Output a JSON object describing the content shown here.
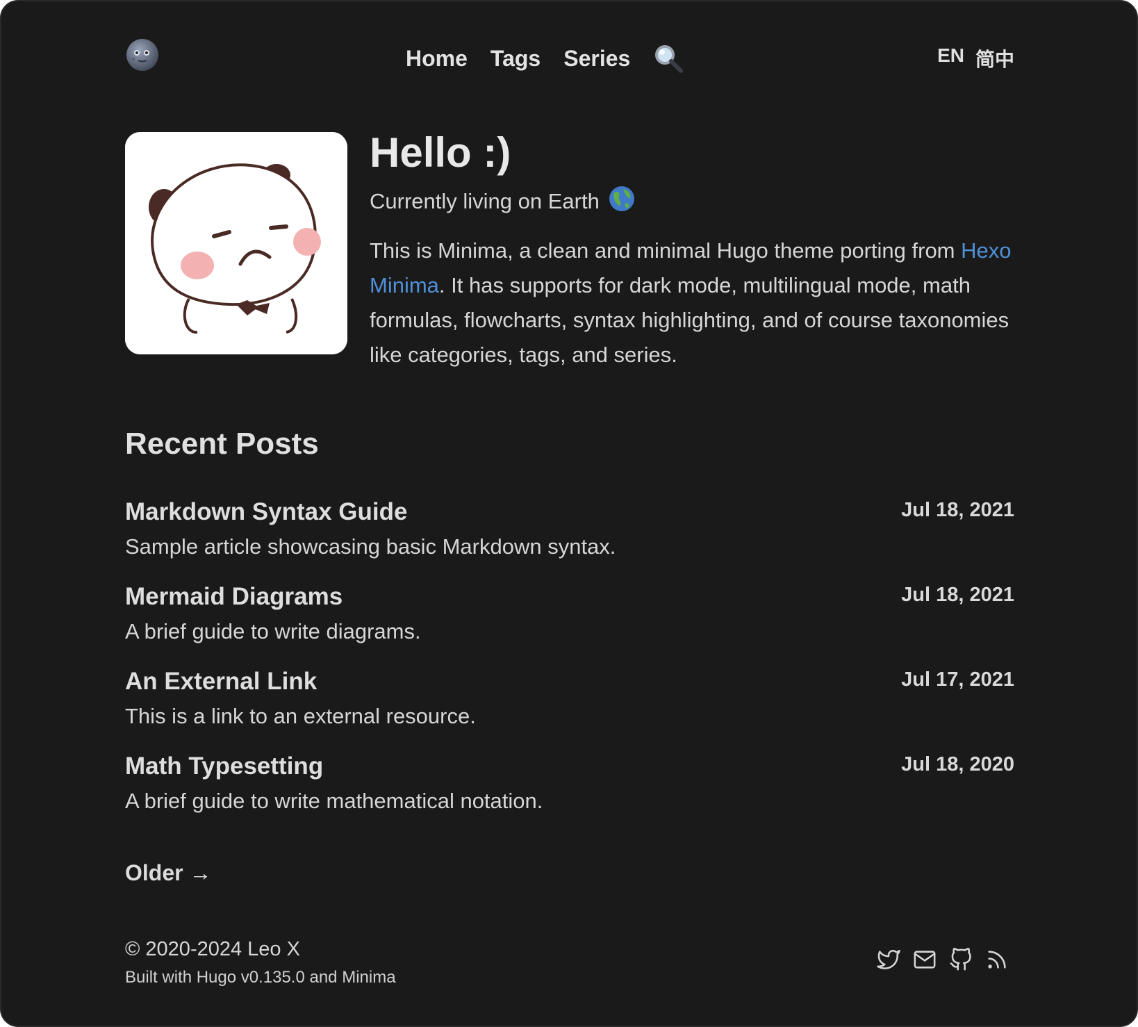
{
  "header": {
    "logo_icon": "moon-face-icon",
    "nav": [
      "Home",
      "Tags",
      "Series"
    ],
    "search_icon": "magnifier-icon",
    "languages": [
      "EN",
      "简中"
    ]
  },
  "intro": {
    "avatar_icon": "panda-sticker-image",
    "title": "Hello :)",
    "subtitle": "Currently living on Earth",
    "subtitle_icon": "earth-globe-icon",
    "bio_before_link": "This is Minima, a clean and minimal Hugo theme porting from ",
    "bio_link": "Hexo Minima",
    "bio_after_link": ". It has supports for dark mode, multilingual mode, math formulas, flowcharts, syntax highlighting, and of course taxonomies like categories, tags, and series.",
    "link_color": "#4f90d9"
  },
  "recent": {
    "title": "Recent Posts",
    "posts": [
      {
        "title": "Markdown Syntax Guide",
        "desc": "Sample article showcasing basic Markdown syntax.",
        "date": "Jul 18, 2021"
      },
      {
        "title": "Mermaid Diagrams",
        "desc": "A brief guide to write diagrams.",
        "date": "Jul 18, 2021"
      },
      {
        "title": "An External Link",
        "desc": "This is a link to an external resource.",
        "date": "Jul 17, 2021"
      },
      {
        "title": "Math Typesetting",
        "desc": "A brief guide to write mathematical notation.",
        "date": "Jul 18, 2020"
      }
    ],
    "older": "Older →"
  },
  "footer": {
    "copyright": "© 2020-2024 Leo X",
    "built_with": "Built with Hugo v0.135.0 and Minima",
    "social_icons": [
      "twitter-icon",
      "mail-icon",
      "github-icon",
      "rss-icon"
    ]
  },
  "colors": {
    "background": "#1a1a1a",
    "text": "#d6d6d6",
    "link": "#4f90d9"
  }
}
